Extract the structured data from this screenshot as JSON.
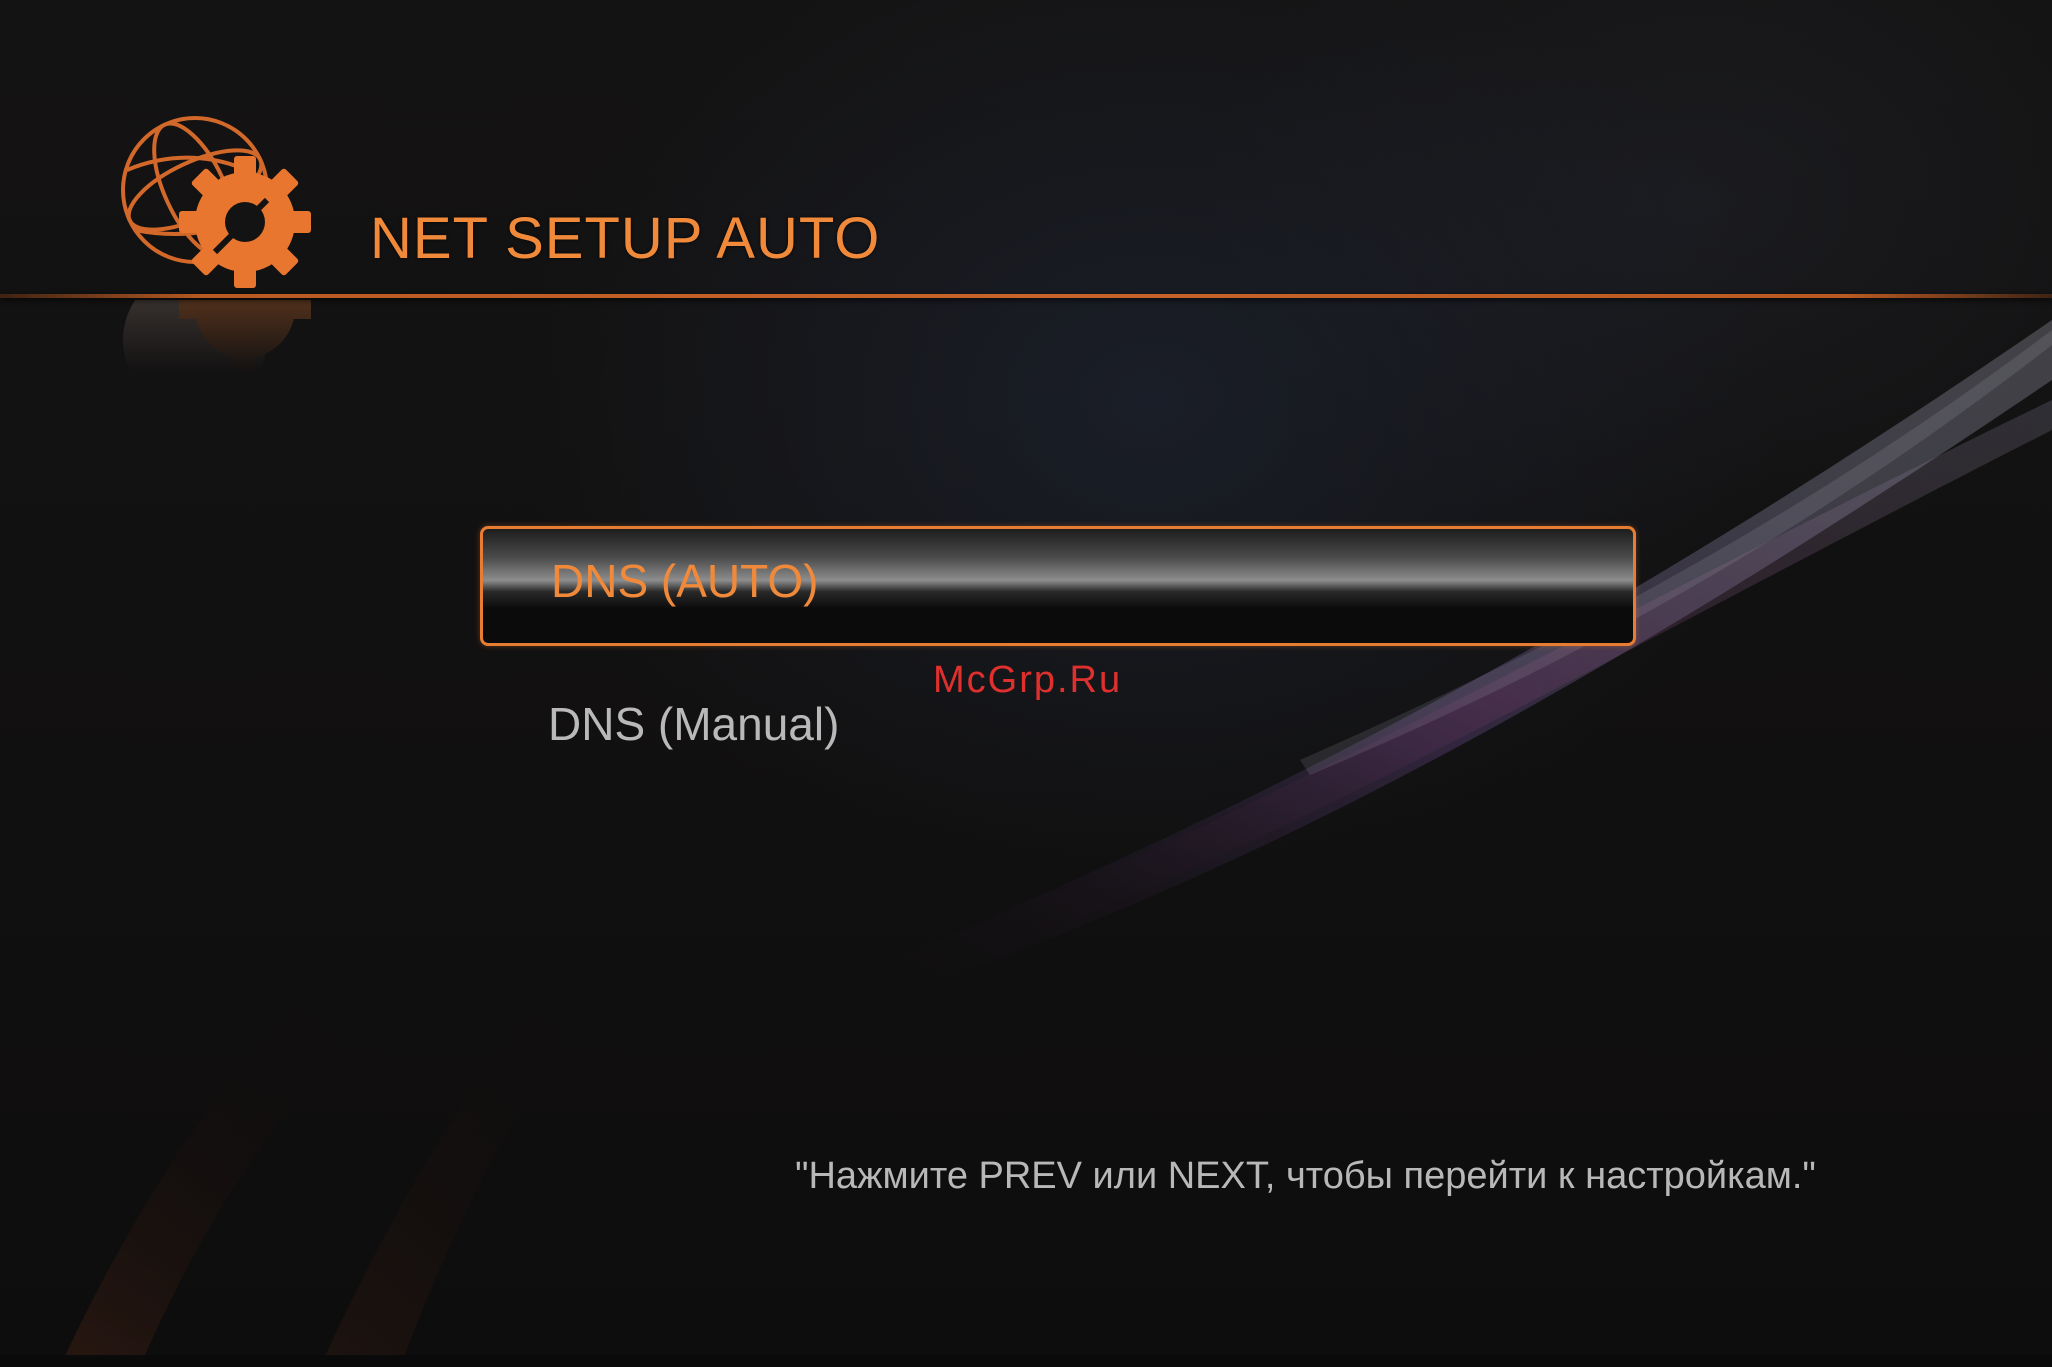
{
  "header": {
    "title": "NET SETUP AUTO",
    "icon": "globe-gear-icon"
  },
  "menu": {
    "items": [
      {
        "label": "DNS (AUTO)",
        "selected": true
      },
      {
        "label": "DNS (Manual)",
        "selected": false
      }
    ]
  },
  "watermark": "McGrp.Ru",
  "hint": "\"Нажмите PREV или NEXT, чтобы перейти к настройкам.\"",
  "colors": {
    "accent": "#f08a3a",
    "highlight_border": "#e77d33",
    "text_secondary": "#b9b9b9",
    "watermark": "#e0302e",
    "background": "#121111"
  }
}
